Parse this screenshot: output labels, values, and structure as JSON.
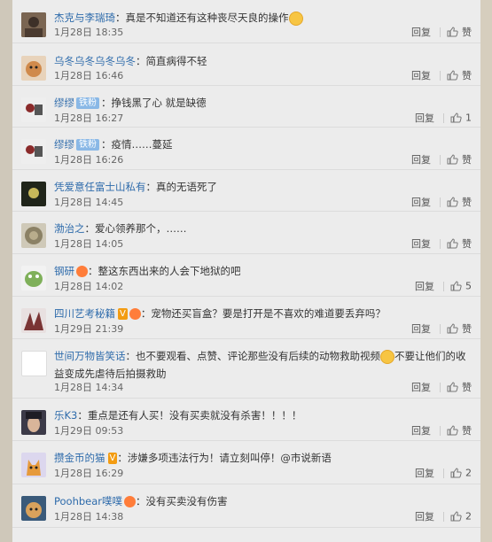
{
  "comments": [
    {
      "user": "杰克与李瑞琦",
      "badge": "",
      "vip": "",
      "text": "：真是不知道还有这种丧尽天良的操作",
      "emoji": true,
      "date": "1月28日 18:35",
      "reply": "回复",
      "likes": "赞"
    },
    {
      "user": "乌冬乌冬乌冬乌冬",
      "badge": "",
      "vip": "",
      "text": "：简直病得不轻",
      "emoji": false,
      "date": "1月28日 16:46",
      "reply": "回复",
      "likes": "赞"
    },
    {
      "user": "缪缪",
      "badge": "铁粉",
      "vip": "",
      "text": "：挣钱黑了心 就是缺德",
      "emoji": false,
      "date": "1月28日 16:27",
      "reply": "回复",
      "likes": "1"
    },
    {
      "user": "缪缪",
      "badge": "铁粉",
      "vip": "",
      "text": "：疫情……蔓延",
      "emoji": false,
      "date": "1月28日 16:26",
      "reply": "回复",
      "likes": "赞"
    },
    {
      "user": "凭爱意任富士山私有",
      "badge": "",
      "vip": "",
      "text": "：真的无语死了",
      "emoji": false,
      "date": "1月28日 14:45",
      "reply": "回复",
      "likes": "赞"
    },
    {
      "user": "渤治之",
      "badge": "",
      "vip": "",
      "text": "：爱心领养那个，……",
      "emoji": false,
      "date": "1月28日 14:05",
      "reply": "回复",
      "likes": "赞"
    },
    {
      "user": "钢研",
      "badge": "",
      "vip": "",
      "text": "：整这东西出来的人会下地狱的吧",
      "emoji": false,
      "date": "1月28日 14:02",
      "reply": "回复",
      "likes": "5"
    },
    {
      "user": "四川艺考秘籍",
      "badge": "",
      "vip": "V",
      "text": "：宠物还买盲盒？要是打开是不喜欢的难道要丢弃吗？",
      "emoji": false,
      "date": "1月29日 21:39",
      "reply": "回复",
      "likes": "赞"
    },
    {
      "user": "世间万物皆笑话",
      "badge": "",
      "vip": "",
      "text": "：也不要观看、点赞、评论那些没有后续的动物救助视频",
      "text2": "不要让他们的收益变成先虐待后拍摄救助",
      "emoji": true,
      "date": "1月28日 14:34",
      "reply": "回复",
      "likes": "赞"
    },
    {
      "user": "乐K3",
      "badge": "",
      "vip": "",
      "text": "：重点是还有人买！没有买卖就没有杀害！！！！",
      "emoji": false,
      "date": "1月29日 09:53",
      "reply": "回复",
      "likes": "赞"
    },
    {
      "user": "攒金币的猫",
      "badge": "",
      "vip": "V",
      "text": "：涉嫌多项违法行为！请立刻叫停！@市说新语",
      "emoji": false,
      "date": "1月28日 16:29",
      "reply": "回复",
      "likes": "2"
    },
    {
      "user": "Poohbear噗噗",
      "badge": "",
      "vip": "",
      "text": "：没有买卖没有伤害",
      "emoji": false,
      "date": "1月28日 14:38",
      "reply": "回复",
      "likes": "2"
    }
  ],
  "colors": {
    "link": "#2e6bab",
    "panel": "#ececec",
    "background": "#c9c2b4"
  }
}
